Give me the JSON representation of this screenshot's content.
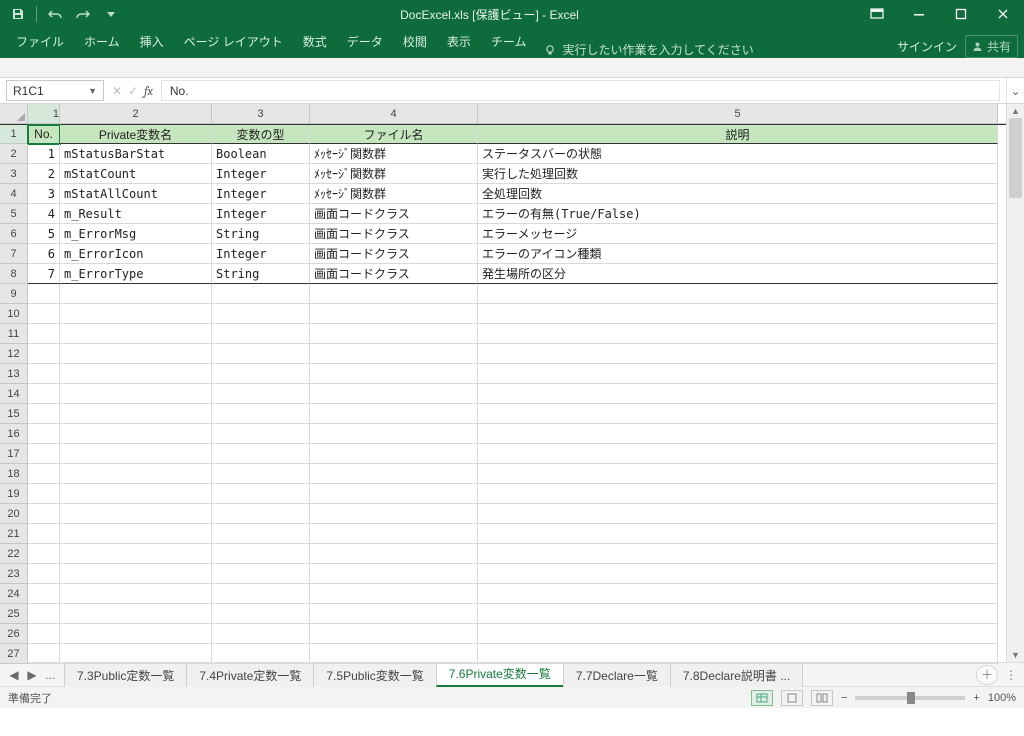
{
  "title": "DocExcel.xls  [保護ビュー] - Excel",
  "ribbon": {
    "tabs": [
      "ファイル",
      "ホーム",
      "挿入",
      "ページ レイアウト",
      "数式",
      "データ",
      "校閲",
      "表示",
      "チーム"
    ],
    "tell_me": "実行したい作業を入力してください",
    "signin": "サインイン",
    "share": "共有"
  },
  "namebox": "R1C1",
  "formula": "No.",
  "columns": [
    "1",
    "2",
    "3",
    "4",
    "5"
  ],
  "headers": {
    "c1": "No.",
    "c2": "Private変数名",
    "c3": "変数の型",
    "c4": "ファイル名",
    "c5": "説明"
  },
  "rows": [
    {
      "n": "1",
      "name": "mStatusBarStat",
      "type": "Boolean",
      "file": "ﾒｯｾｰｼﾞ関数群",
      "desc": "ステータスバーの状態"
    },
    {
      "n": "2",
      "name": "mStatCount",
      "type": "Integer",
      "file": "ﾒｯｾｰｼﾞ関数群",
      "desc": "実行した処理回数"
    },
    {
      "n": "3",
      "name": "mStatAllCount",
      "type": "Integer",
      "file": "ﾒｯｾｰｼﾞ関数群",
      "desc": "全処理回数"
    },
    {
      "n": "4",
      "name": "m_Result",
      "type": "Integer",
      "file": "画面コードクラス",
      "desc": "エラーの有無(True/False)"
    },
    {
      "n": "5",
      "name": "m_ErrorMsg",
      "type": "String",
      "file": "画面コードクラス",
      "desc": "エラーメッセージ"
    },
    {
      "n": "6",
      "name": "m_ErrorIcon",
      "type": "Integer",
      "file": "画面コードクラス",
      "desc": "エラーのアイコン種類"
    },
    {
      "n": "7",
      "name": "m_ErrorType",
      "type": "String",
      "file": "画面コードクラス",
      "desc": "発生場所の区分"
    }
  ],
  "row_numbers": [
    "1",
    "2",
    "3",
    "4",
    "5",
    "6",
    "7",
    "8",
    "9",
    "10",
    "11",
    "12",
    "13",
    "14",
    "15",
    "16",
    "17",
    "18",
    "19",
    "20",
    "21",
    "22",
    "23",
    "24",
    "25",
    "26",
    "27"
  ],
  "sheet_tabs": {
    "ellipsis": "...",
    "tabs": [
      {
        "label": "7.3Public定数一覧",
        "active": false
      },
      {
        "label": "7.4Private定数一覧",
        "active": false
      },
      {
        "label": "7.5Public変数一覧",
        "active": false
      },
      {
        "label": "7.6Private変数一覧",
        "active": true
      },
      {
        "label": "7.7Declare一覧",
        "active": false
      },
      {
        "label": "7.8Declare説明書 ...",
        "active": false
      }
    ]
  },
  "status": {
    "ready": "準備完了",
    "zoom": "100%"
  }
}
